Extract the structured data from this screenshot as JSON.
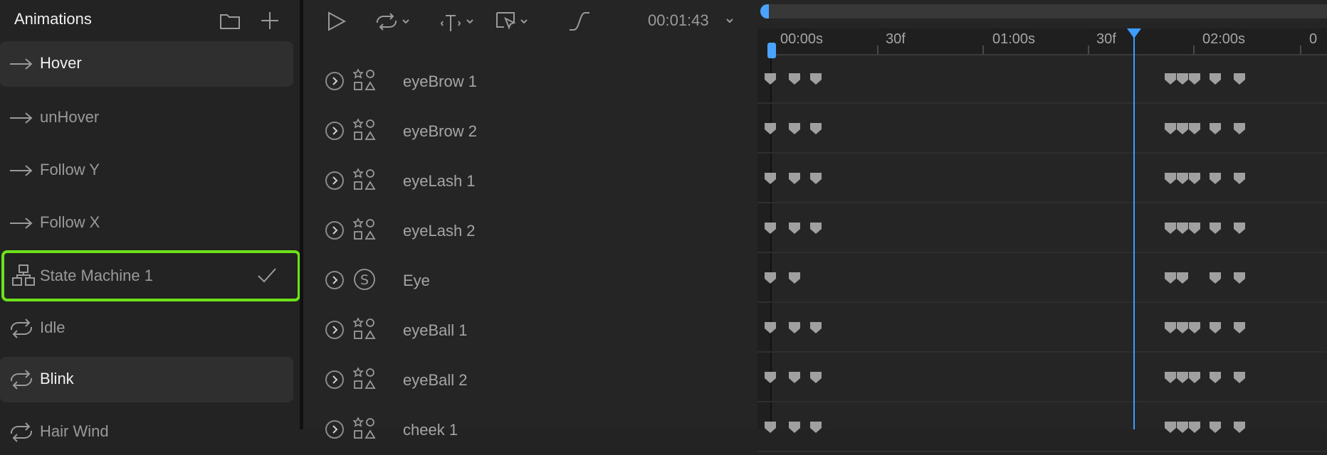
{
  "animations_panel": {
    "title": "Animations",
    "items": [
      {
        "label": "Hover",
        "icon": "arrow-right-icon",
        "active": true
      },
      {
        "label": "unHover",
        "icon": "arrow-right-icon"
      },
      {
        "label": "Follow Y",
        "icon": "arrow-right-icon"
      },
      {
        "label": "Follow X",
        "icon": "arrow-right-icon"
      },
      {
        "label": "State Machine 1",
        "icon": "state-machine-icon",
        "selected": true
      },
      {
        "label": "Idle",
        "icon": "loop-icon"
      },
      {
        "label": "Blink",
        "icon": "loop-icon",
        "active": true
      },
      {
        "label": "Hair Wind",
        "icon": "loop-icon"
      }
    ]
  },
  "timeline_toolbar": {
    "time": "00:01:43",
    "icons": [
      "play-icon",
      "loop-mode-icon",
      "key-interpolation-icon",
      "select-mode-icon",
      "easing-curve-icon"
    ]
  },
  "layers": [
    {
      "label": "eyeBrow 1",
      "type": "shapes-icon"
    },
    {
      "label": "eyeBrow 2",
      "type": "shapes-icon"
    },
    {
      "label": "eyeLash 1",
      "type": "shapes-icon"
    },
    {
      "label": "eyeLash 2",
      "type": "shapes-icon"
    },
    {
      "label": "Eye",
      "type": "solo-icon"
    },
    {
      "label": "eyeBall 1",
      "type": "shapes-icon"
    },
    {
      "label": "eyeBall 2",
      "type": "shapes-icon"
    },
    {
      "label": "cheek 1",
      "type": "shapes-icon"
    }
  ],
  "ruler": {
    "labels": [
      "00:00s",
      "30f",
      "01:00s",
      "30f",
      "02:00s",
      "0"
    ]
  },
  "colors": {
    "accent": "#3d9cff",
    "selection_outline": "#6ce21b",
    "keyframe": "#a0a0a0"
  }
}
